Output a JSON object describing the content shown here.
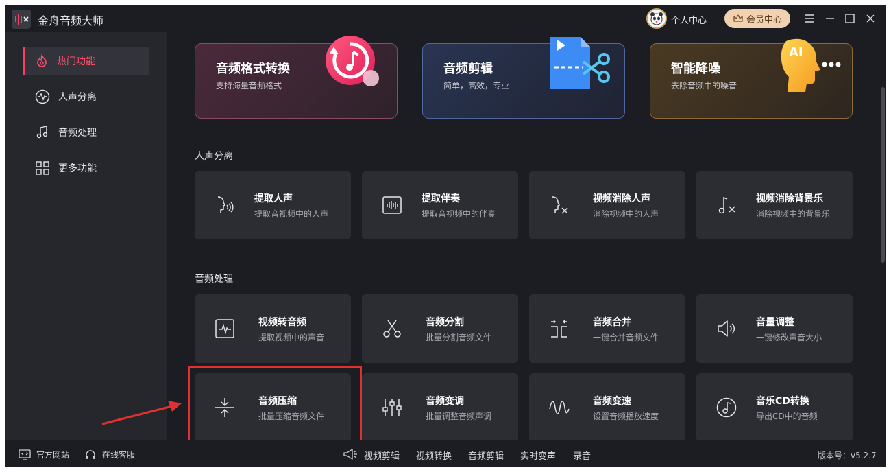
{
  "app": {
    "title": "金舟音频大师"
  },
  "header": {
    "user_center": "个人中心",
    "vip_label": "会员中心"
  },
  "sidebar": {
    "items": [
      {
        "label": "热门功能",
        "icon": "fire-icon",
        "active": true
      },
      {
        "label": "人声分离",
        "icon": "waveform-circle-icon",
        "active": false
      },
      {
        "label": "音频处理",
        "icon": "music-note-icon",
        "active": false
      },
      {
        "label": "更多功能",
        "icon": "grid-icon",
        "active": false
      }
    ]
  },
  "hero": [
    {
      "title": "音频格式转换",
      "sub": "支持海量音频格式",
      "icon": "music-convert-icon"
    },
    {
      "title": "音频剪辑",
      "sub": "简单，高效，专业",
      "icon": "file-scissors-icon"
    },
    {
      "title": "智能降噪",
      "sub": "去除音频中的噪音",
      "icon": "ai-head-icon",
      "badge": "AI"
    }
  ],
  "sections": {
    "vocal": {
      "title": "人声分离",
      "cards": [
        {
          "title": "提取人声",
          "sub": "提取音视频中的人声",
          "icon": "voice-face-icon"
        },
        {
          "title": "提取伴奏",
          "sub": "提取音视频中的伴奏",
          "icon": "waveform-box-icon"
        },
        {
          "title": "视频消除人声",
          "sub": "消除视频中的人声",
          "icon": "voice-remove-icon"
        },
        {
          "title": "视频消除背景乐",
          "sub": "消除视频中的背景乐",
          "icon": "music-remove-icon"
        }
      ]
    },
    "audio": {
      "title": "音频处理",
      "cards": [
        {
          "title": "视频转音频",
          "sub": "提取视频中的声音",
          "icon": "video-to-audio-icon"
        },
        {
          "title": "音频分割",
          "sub": "批量分割音频文件",
          "icon": "scissors-icon"
        },
        {
          "title": "音频合并",
          "sub": "一键合并音频文件",
          "icon": "merge-icon"
        },
        {
          "title": "音量调整",
          "sub": "一键修改声音大小",
          "icon": "speaker-icon"
        },
        {
          "title": "音频压缩",
          "sub": "批量压缩音频文件",
          "icon": "compress-icon"
        },
        {
          "title": "音频变调",
          "sub": "批量调整音频声调",
          "icon": "sliders-icon"
        },
        {
          "title": "音频变速",
          "sub": "设置音频播放速度",
          "icon": "wave-speed-icon"
        },
        {
          "title": "音乐CD转换",
          "sub": "导出CD中的音频",
          "icon": "cd-music-icon"
        }
      ]
    }
  },
  "footer": {
    "website": "官方网站",
    "support": "在线客服",
    "tools": [
      "视频剪辑",
      "视频转换",
      "音频剪辑",
      "实时变声",
      "录音"
    ],
    "version": "版本号：v5.2.7"
  },
  "colors": {
    "accent": "#ff3d5e",
    "highlight": "#e0302f"
  }
}
